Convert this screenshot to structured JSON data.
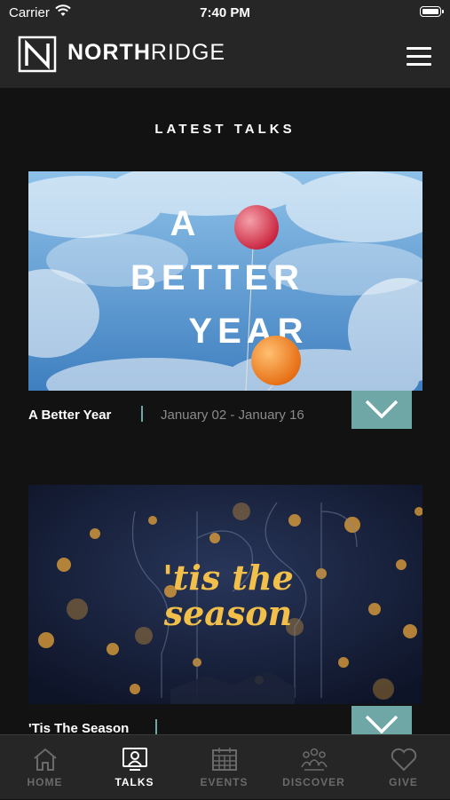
{
  "status_bar": {
    "carrier": "Carrier",
    "time": "7:40 PM"
  },
  "header": {
    "brand_bold": "NORTH",
    "brand_light": "RIDGE"
  },
  "section": {
    "title": "LATEST TALKS"
  },
  "talks": [
    {
      "title": "A Better Year",
      "date": "January 02 - January 16",
      "artwork_words": [
        "A",
        "BETTER",
        "YEAR"
      ]
    },
    {
      "title": "'Tis The Season",
      "date": "",
      "artwork_words": [
        "'tis the",
        "season"
      ]
    }
  ],
  "tabs": [
    {
      "label": "HOME",
      "icon": "home-icon",
      "active": false
    },
    {
      "label": "TALKS",
      "icon": "talks-icon",
      "active": true
    },
    {
      "label": "EVENTS",
      "icon": "calendar-icon",
      "active": false
    },
    {
      "label": "DISCOVER",
      "icon": "people-icon",
      "active": false
    },
    {
      "label": "GIVE",
      "icon": "heart-icon",
      "active": false
    }
  ],
  "colors": {
    "accent": "#6fa6a6",
    "background": "#121212",
    "bar": "#262626"
  }
}
